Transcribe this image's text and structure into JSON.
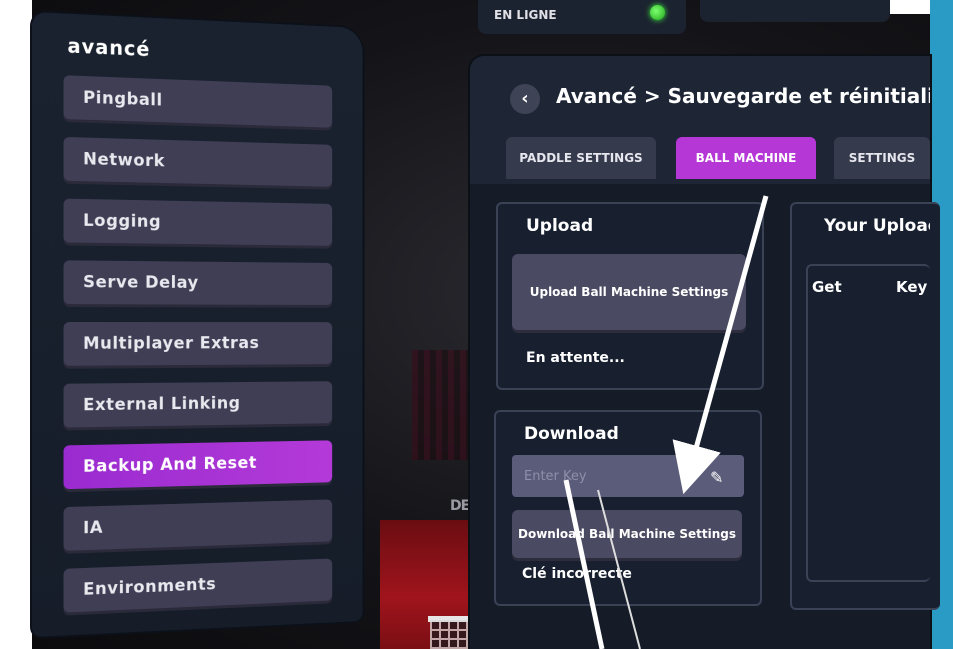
{
  "left_panel": {
    "title": "avancé",
    "items": [
      {
        "label": "Pingball"
      },
      {
        "label": "Network"
      },
      {
        "label": "Logging"
      },
      {
        "label": "Serve Delay"
      },
      {
        "label": "Multiplayer Extras"
      },
      {
        "label": "External Linking"
      },
      {
        "label": "Backup And Reset",
        "active": true
      },
      {
        "label": "IA"
      },
      {
        "label": "Environments"
      }
    ]
  },
  "status_bar": {
    "label": "EN LIGNE",
    "indicator_color": "#3cff3c"
  },
  "header": {
    "breadcrumb": "Avancé > Sauvegarde et réinitialis"
  },
  "tabs": [
    {
      "label": "PADDLE SETTINGS"
    },
    {
      "label": "BALL MACHINE",
      "active": true
    },
    {
      "label": "SETTINGS"
    }
  ],
  "upload": {
    "title": "Upload",
    "button_label": "Upload Ball Machine Settings",
    "status": "En attente..."
  },
  "download": {
    "title": "Download",
    "key_placeholder": "Enter Key",
    "button_label": "Download Ball Machine Settings",
    "status": "Clé incorrecte"
  },
  "uploads_panel": {
    "title": "Your Uploac",
    "columns": [
      "Get",
      "Key"
    ]
  },
  "background": {
    "brand_text": "DECIT"
  },
  "colors": {
    "accent": "#b437d6",
    "panel": "#151c28",
    "button": "#4a4a62",
    "annotation": "#ffffff"
  }
}
